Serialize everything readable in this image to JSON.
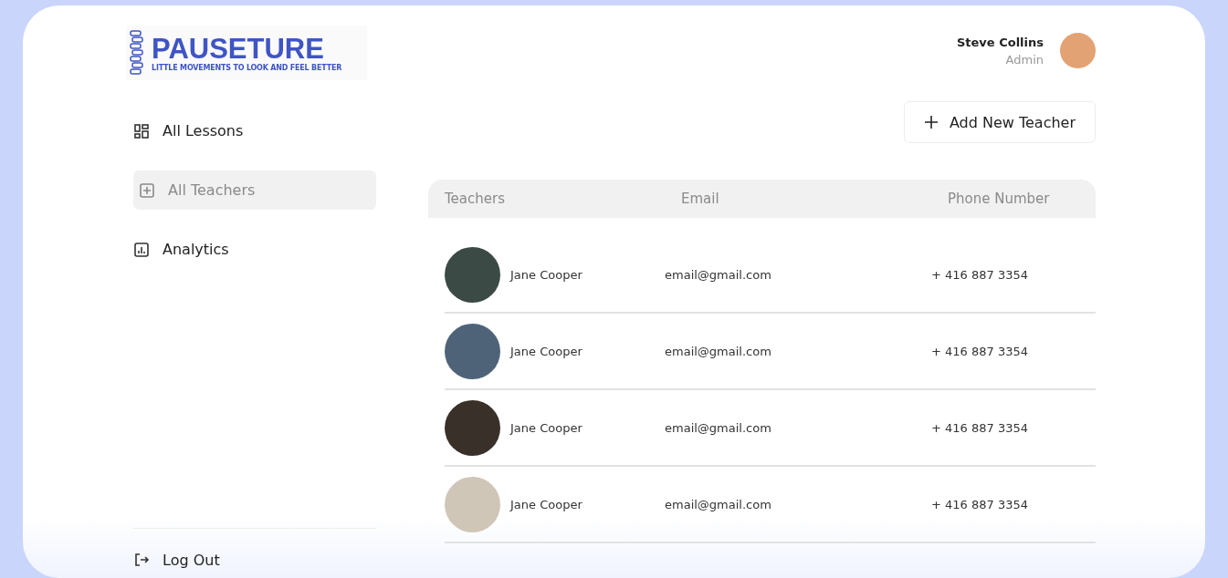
{
  "logo": {
    "name": "PAUSETURE",
    "tagline": "LITTLE MOVEMENTS TO LOOK AND FEEL BETTER"
  },
  "user": {
    "name": "Steve Collins",
    "role": "Admin"
  },
  "sidebar": {
    "items": [
      {
        "kind": "lessons",
        "label": "All Lessons",
        "selected": false
      },
      {
        "kind": "teachers",
        "label": "All Teachers",
        "selected": true
      },
      {
        "kind": "analytics",
        "label": "Analytics",
        "selected": false
      }
    ],
    "logout": "Log Out"
  },
  "add_button": "Add New Teacher",
  "table": {
    "columns": [
      "Teachers",
      "Email",
      "Phone Number"
    ],
    "rows": [
      {
        "name": "Jane Cooper",
        "email": "email@gmail.com",
        "phone": "+ 416 887 3354"
      },
      {
        "name": "Jane Cooper",
        "email": "email@gmail.com",
        "phone": "+ 416 887 3354"
      },
      {
        "name": "Jane Cooper",
        "email": "email@gmail.com",
        "phone": "+ 416 887 3354"
      },
      {
        "name": "Jane Cooper",
        "email": "email@gmail.com",
        "phone": "+ 416 887 3354"
      }
    ]
  }
}
